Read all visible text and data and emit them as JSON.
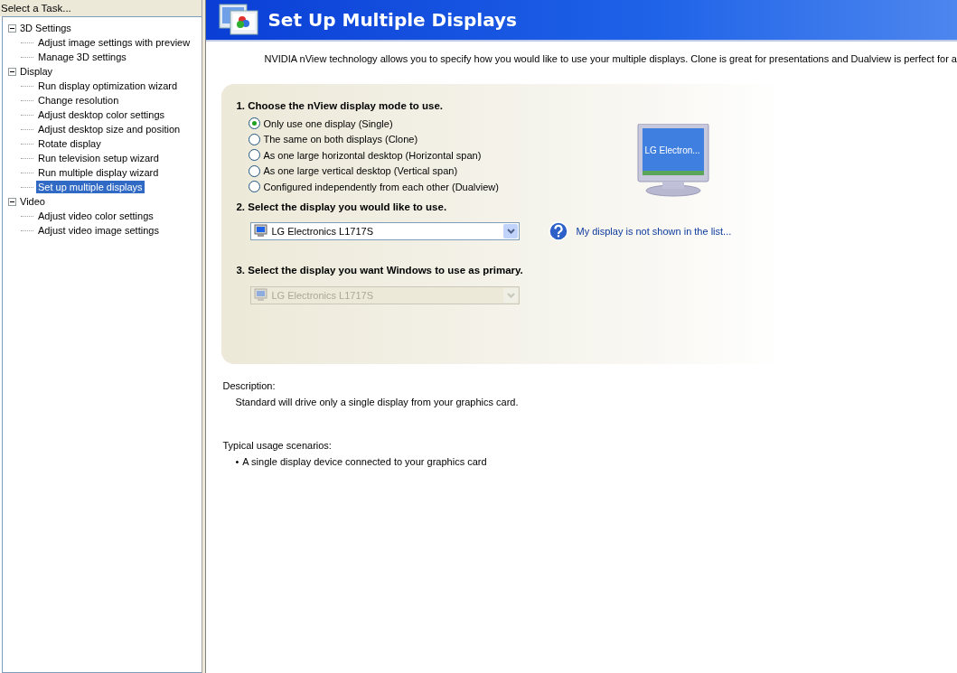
{
  "sidebar": {
    "title": "Select a Task...",
    "tree": [
      {
        "label": "3D Settings",
        "expanded": true,
        "children": [
          {
            "label": "Adjust image settings with preview",
            "selected": false
          },
          {
            "label": "Manage 3D settings",
            "selected": false
          }
        ]
      },
      {
        "label": "Display",
        "expanded": true,
        "children": [
          {
            "label": "Run display optimization wizard",
            "selected": false
          },
          {
            "label": "Change resolution",
            "selected": false
          },
          {
            "label": "Adjust desktop color settings",
            "selected": false
          },
          {
            "label": "Adjust desktop size and position",
            "selected": false
          },
          {
            "label": "Rotate display",
            "selected": false
          },
          {
            "label": "Run television setup wizard",
            "selected": false
          },
          {
            "label": "Run multiple display wizard",
            "selected": false
          },
          {
            "label": "Set up multiple displays",
            "selected": true
          }
        ]
      },
      {
        "label": "Video",
        "expanded": true,
        "children": [
          {
            "label": "Adjust video color settings",
            "selected": false
          },
          {
            "label": "Adjust video image settings",
            "selected": false
          }
        ]
      }
    ]
  },
  "header": {
    "title": "Set Up Multiple Displays"
  },
  "intro": "NVIDIA nView technology allows you to specify how you would like to use your multiple displays. Clone is great for presentations and Dualview is perfect for a",
  "step1": {
    "heading": "1. Choose the nView display mode to use.",
    "options": [
      {
        "label": "Only use one display (Single)",
        "selected": true
      },
      {
        "label": "The same on both displays (Clone)",
        "selected": false
      },
      {
        "label": "As one large horizontal desktop (Horizontal span)",
        "selected": false
      },
      {
        "label": "As one large vertical desktop (Vertical span)",
        "selected": false
      },
      {
        "label": "Configured independently from each other (Dualview)",
        "selected": false
      }
    ],
    "monitor_label": "LG Electron..."
  },
  "step2": {
    "heading": "2. Select the display you would like to use.",
    "dropdown": {
      "value": "LG Electronics L1717S",
      "disabled": false
    },
    "help_link": "My display is not shown in the list..."
  },
  "step3": {
    "heading": "3. Select the display you want Windows to use as primary.",
    "dropdown": {
      "value": "LG Electronics L1717S",
      "disabled": true
    }
  },
  "description": {
    "heading": "Description:",
    "text": "Standard will drive only a single display from your graphics card."
  },
  "usage": {
    "heading": "Typical usage scenarios:",
    "items": [
      {
        "bullet": "•",
        "text": "A single display device connected to your graphics card"
      }
    ]
  }
}
